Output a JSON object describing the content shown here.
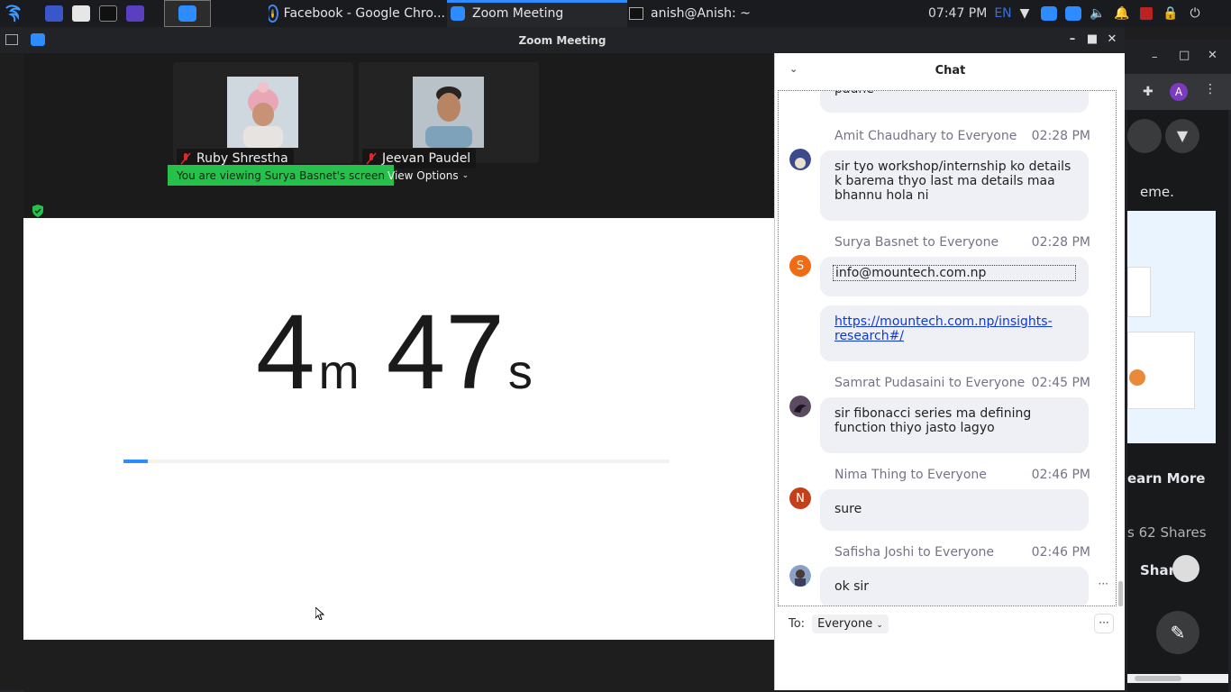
{
  "taskbar": {
    "tasks": [
      {
        "label": "Facebook - Google Chro...",
        "icon": "chrome-icon"
      },
      {
        "label": "Zoom Meeting",
        "icon": "zoom-icon"
      },
      {
        "label": "anish@Anish: ~",
        "icon": "terminal-icon"
      }
    ],
    "clock": "07:47 PM",
    "lang": "EN"
  },
  "window": {
    "title": "Zoom Meeting"
  },
  "participants": [
    {
      "name": "Ruby Shrestha"
    },
    {
      "name": "Jeevan Paudel"
    }
  ],
  "share_banner": {
    "viewing_text": "You are viewing Surya  Basnet's screen",
    "view_options": "View Options"
  },
  "timer": {
    "minutes": "4",
    "minutes_unit": "m",
    "seconds": "47",
    "seconds_unit": "s",
    "progress": 0.045
  },
  "chat": {
    "title": "Chat",
    "partial_top": "paune",
    "messages": [
      {
        "sender": "Amit Chaudhary to Everyone",
        "time": "02:28 PM",
        "lines": [
          "sir tyo workshop/internship ko details",
          "k barema thyo last ma details maa",
          "bhannu hola ni"
        ]
      },
      {
        "sender": "Surya Basnet to Everyone",
        "time": "02:28 PM",
        "email": "info@mountech.com.np",
        "link_line1": "https://mountech.com.np/insights-",
        "link_line2": "research#/"
      },
      {
        "sender": "Samrat Pudasaini to Everyone",
        "time": "02:45 PM",
        "lines": [
          "sir fibonacci series ma defining",
          "function thiyo jasto lagyo"
        ]
      },
      {
        "sender": "Nima Thing to Everyone",
        "time": "02:46 PM",
        "lines": [
          "sure"
        ]
      },
      {
        "sender": "Safisha Joshi to Everyone",
        "time": "02:46 PM",
        "lines": [
          "ok sir"
        ]
      }
    ],
    "avatar_letters": {
      "surya": "S",
      "nima": "N"
    },
    "to_label": "To:",
    "to_value": "Everyone"
  },
  "chrome_bg": {
    "profile_letter": "A",
    "snippet_theme": "eme.",
    "learn_more": "earn More",
    "shares": "s  62 Shares",
    "share": "Share"
  }
}
